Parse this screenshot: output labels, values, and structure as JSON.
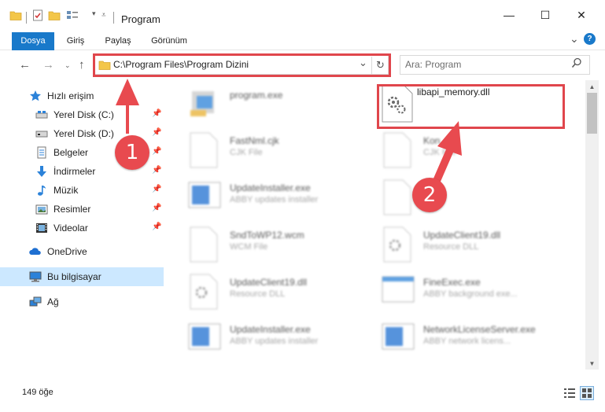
{
  "window": {
    "title": "Program",
    "minimize": "—",
    "maximize": "☐",
    "close": "✕"
  },
  "ribbon": {
    "tabs": [
      "Dosya",
      "Giriş",
      "Paylaş",
      "Görünüm"
    ],
    "expand": "⌄",
    "help": "?"
  },
  "address": {
    "path": "C:\\Program Files\\Program Dizini",
    "dropdown": "⌄",
    "refresh": "↻"
  },
  "search": {
    "placeholder": "Ara: Program"
  },
  "sidebar": {
    "items": [
      {
        "label": "Hızlı erişim",
        "icon": "star-icon",
        "pinned": false
      },
      {
        "label": "Yerel Disk (C:)",
        "icon": "drive-icon",
        "pinned": true
      },
      {
        "label": "Yerel Disk (D:)",
        "icon": "drive-icon",
        "pinned": true
      },
      {
        "label": "Belgeler",
        "icon": "documents-icon",
        "pinned": true
      },
      {
        "label": "İndirmeler",
        "icon": "download-icon",
        "pinned": true
      },
      {
        "label": "Müzik",
        "icon": "music-icon",
        "pinned": true
      },
      {
        "label": "Resimler",
        "icon": "pictures-icon",
        "pinned": true
      },
      {
        "label": "Videolar",
        "icon": "video-icon",
        "pinned": true
      },
      {
        "label": "OneDrive",
        "icon": "cloud-icon",
        "pinned": false
      },
      {
        "label": "Bu bilgisayar",
        "icon": "computer-icon",
        "pinned": false
      },
      {
        "label": "Ağ",
        "icon": "network-icon",
        "pinned": false
      }
    ],
    "pin_glyph": "📌"
  },
  "files": {
    "highlighted": {
      "name": "libapi_memory.dll",
      "type": ""
    },
    "items": [
      {
        "name": "program.exe",
        "type": ""
      },
      {
        "name": "FastNml.cjk",
        "type": "CJK File"
      },
      {
        "name": "Kon...cjk",
        "type": "CJK File"
      },
      {
        "name": "UpdateInstaller.exe",
        "type": "ABBY updates installer"
      },
      {
        "name": "",
        "type": ""
      },
      {
        "name": "SndToWP12.wcm",
        "type": "WCM File"
      },
      {
        "name": "UpdateClient19.dll",
        "type": "Resource DLL"
      },
      {
        "name": "UpdateClient19.dll",
        "type": "Resource DLL"
      },
      {
        "name": "FineExec.exe",
        "type": "ABBY background exe..."
      },
      {
        "name": "UpdateInstaller.exe",
        "type": "ABBY updates installer"
      },
      {
        "name": "NetworkLicenseServer.exe",
        "type": "ABBY network licens..."
      }
    ]
  },
  "status": {
    "count": "149 öğe"
  },
  "callouts": [
    "1",
    "2"
  ],
  "colors": {
    "accent": "#1979ca",
    "annotation_red": "#e0464c",
    "selected_bg": "#cce8ff"
  }
}
